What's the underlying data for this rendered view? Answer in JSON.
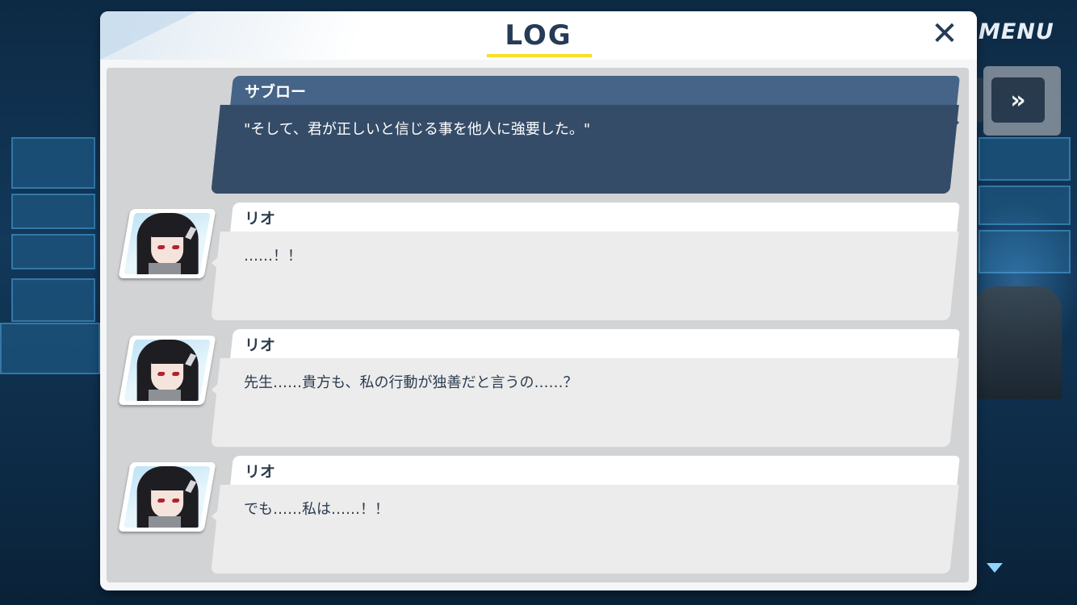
{
  "background": {
    "menu_label": "MENU",
    "fast_forward_icon": "»"
  },
  "log": {
    "title": "LOG",
    "close_icon": "✕",
    "entries": [
      {
        "speaker": "サブロー",
        "text": "\"そして、君が正しいと信じる事を他人に強要した。\"",
        "is_player": true
      },
      {
        "speaker": "リオ",
        "text": "……！！",
        "is_player": false,
        "avatar": "rio-portrait"
      },
      {
        "speaker": "リオ",
        "text": "先生……貴方も、私の行動が独善だと言うの……？",
        "is_player": false,
        "avatar": "rio-portrait"
      },
      {
        "speaker": "リオ",
        "text": "でも……私は……！！",
        "is_player": false,
        "avatar": "rio-portrait"
      }
    ]
  },
  "colors": {
    "title_text": "#253b57",
    "title_underline": "#f7df25",
    "player_bubble": "#354c68",
    "player_name_bar": "#456487",
    "npc_bubble": "#ececec"
  }
}
